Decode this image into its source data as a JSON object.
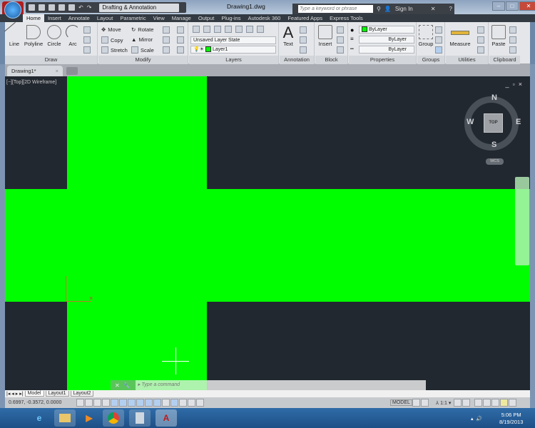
{
  "app": {
    "logo": "A",
    "workspace": "Drafting & Annotation",
    "title": "Drawing1.dwg",
    "search_placeholder": "Type a keyword or phrase",
    "sign_in": "Sign In"
  },
  "tabs": [
    "Home",
    "Insert",
    "Annotate",
    "Layout",
    "Parametric",
    "View",
    "Manage",
    "Output",
    "Plug-ins",
    "Autodesk 360",
    "Featured Apps",
    "Express Tools"
  ],
  "active_tab": "Home",
  "ribbon": {
    "draw": {
      "title": "Draw",
      "items": [
        "Line",
        "Polyline",
        "Circle",
        "Arc"
      ]
    },
    "modify": {
      "title": "Modify",
      "items": [
        "Move",
        "Rotate",
        "Copy",
        "Mirror",
        "Stretch",
        "Scale"
      ]
    },
    "layers": {
      "title": "Layers",
      "layer_state": "Unsaved Layer State",
      "layer": "Layer1"
    },
    "annotation": {
      "title": "Annotation",
      "text": "Text"
    },
    "block": {
      "title": "Block",
      "insert": "Insert"
    },
    "properties": {
      "title": "Properties",
      "color": "ByLayer",
      "linetype": "ByLayer",
      "lineweight": "ByLayer"
    },
    "groups": {
      "title": "Groups",
      "group": "Group"
    },
    "utilities": {
      "title": "Utilities",
      "measure": "Measure"
    },
    "clipboard": {
      "title": "Clipboard",
      "paste": "Paste"
    }
  },
  "document_tab": "Drawing1*",
  "viewport": {
    "label": "[−][Top][2D Wireframe]",
    "compass": {
      "n": "N",
      "s": "S",
      "e": "E",
      "w": "W",
      "cube": "TOP",
      "wcs": "WCS"
    }
  },
  "command": {
    "placeholder": "Type a command"
  },
  "layout_tabs": [
    "Model",
    "Layout1",
    "Layout2"
  ],
  "status": {
    "coords": "0.6997, -0.3572, 0.0000",
    "model": "MODEL",
    "scale": "1:1"
  },
  "clock": {
    "time": "5:06 PM",
    "date": "8/19/2013"
  },
  "colors": {
    "shape": "#00fe00",
    "background": "#222830"
  }
}
